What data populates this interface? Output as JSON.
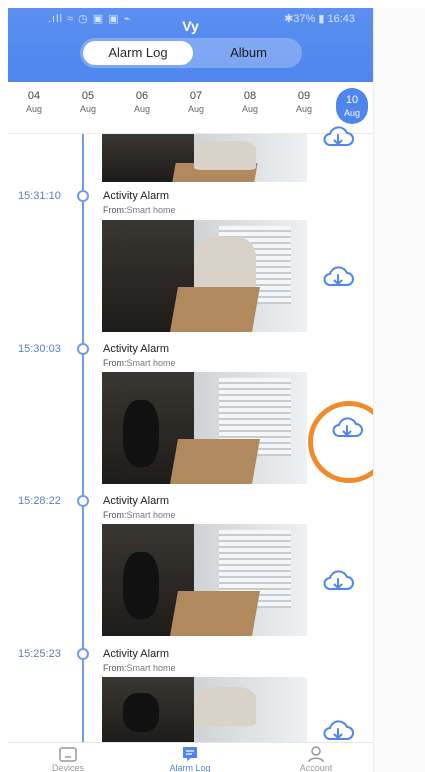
{
  "status": {
    "left": ".ıll ≈ ◷ ▣ ▣ ⌁",
    "right": "✱37% ▮ 16:43"
  },
  "header": {
    "title": "Vy"
  },
  "tabs": {
    "alarm_log": "Alarm Log",
    "album": "Album"
  },
  "dates": [
    {
      "day": "04",
      "month": "Aug"
    },
    {
      "day": "05",
      "month": "Aug"
    },
    {
      "day": "06",
      "month": "Aug"
    },
    {
      "day": "07",
      "month": "Aug"
    },
    {
      "day": "08",
      "month": "Aug"
    },
    {
      "day": "09",
      "month": "Aug"
    },
    {
      "day": "10",
      "month": "Aug",
      "selected": true
    }
  ],
  "events": [
    {
      "time": "15:31:10",
      "title": "Activity Alarm",
      "from_label": "From:",
      "from_source": "Smart home"
    },
    {
      "time": "15:30:03",
      "title": "Activity Alarm",
      "from_label": "From:",
      "from_source": "Smart home"
    },
    {
      "time": "15:28:22",
      "title": "Activity Alarm",
      "from_label": "From:",
      "from_source": "Smart home"
    },
    {
      "time": "15:25:23",
      "title": "Activity Alarm",
      "from_label": "From:",
      "from_source": "Smart home"
    }
  ],
  "bottom_nav": [
    {
      "label": "Devices",
      "icon": "devices-icon"
    },
    {
      "label": "Alarm Log",
      "icon": "alarm-log-icon",
      "active": true
    },
    {
      "label": "Account",
      "icon": "account-icon"
    }
  ],
  "colors": {
    "accent": "#4f86ee",
    "highlight_ring": "#f08a2a",
    "timeline": "#6f9be8"
  }
}
